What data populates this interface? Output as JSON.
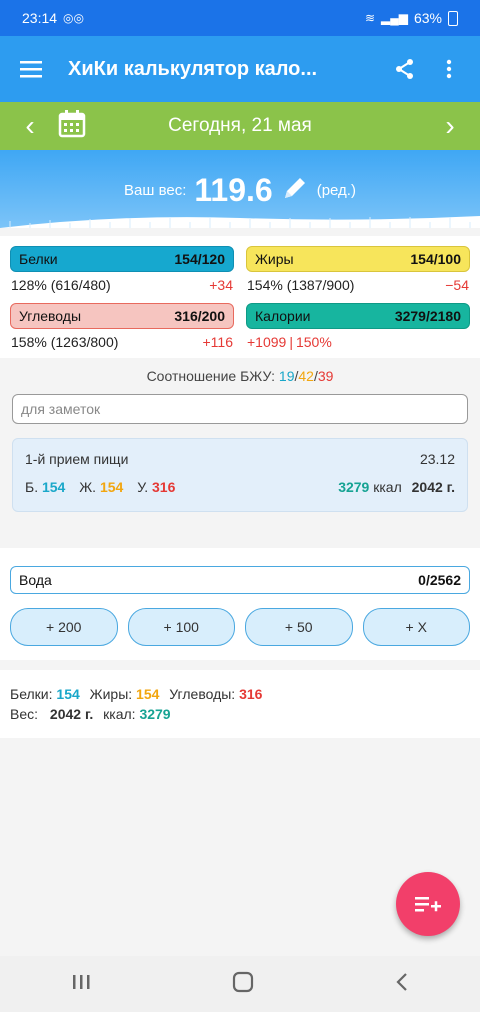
{
  "status": {
    "time": "23:14",
    "battery": "63%"
  },
  "appbar": {
    "title": "ХиКи калькулятор кало..."
  },
  "datebar": {
    "date": "Сегодня, 21 мая",
    "prev": "‹",
    "next": "›"
  },
  "weight": {
    "label": "Ваш вес:",
    "value": "119.6",
    "edit": "(ред.)"
  },
  "macros": {
    "protein": {
      "label": "Белки",
      "value": "154/120",
      "pct": "128% (616/480)",
      "delta": "+34",
      "color": "#16a8cf"
    },
    "fat": {
      "label": "Жиры",
      "value": "154/100",
      "pct": "154% (1387/900)",
      "delta": "−54",
      "color": "#f7e55b"
    },
    "carbs": {
      "label": "Углеводы",
      "value": "316/200",
      "pct": "158% (1263/800)",
      "delta": "+116",
      "color": "#f6c5c0"
    },
    "cal": {
      "label": "Калории",
      "value": "3279/2180",
      "delta": "+1099",
      "pct": "150%",
      "color": "#17b59f"
    }
  },
  "ratio": {
    "label": "Соотношение БЖУ:",
    "p": "19",
    "f": "42",
    "c": "39",
    "sep": "/"
  },
  "notes": {
    "placeholder": "для заметок"
  },
  "meal": {
    "title": "1-й прием пищи",
    "time": "23.12",
    "p_lbl": "Б.",
    "p": "154",
    "f_lbl": "Ж.",
    "f": "154",
    "c_lbl": "У.",
    "c": "316",
    "kcal": "3279",
    "kcal_unit": "ккал",
    "weight": "2042 г."
  },
  "water": {
    "label": "Вода",
    "value": "0/2562",
    "buttons": [
      "+ 200",
      "+ 100",
      "+ 50",
      "+ X"
    ]
  },
  "totals": {
    "p_lbl": "Белки:",
    "p": "154",
    "f_lbl": "Жиры:",
    "f": "154",
    "c_lbl": "Углеводы:",
    "c": "316",
    "w_lbl": "Вес:",
    "w": "2042 г.",
    "k_lbl": "ккал:",
    "k": "3279"
  }
}
